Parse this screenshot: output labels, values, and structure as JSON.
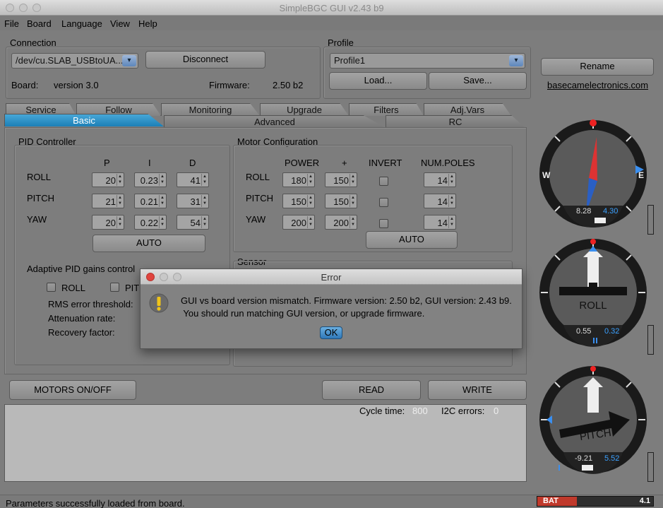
{
  "window": {
    "title": "SimpleBGC GUI v2.43 b9"
  },
  "menu": [
    "File",
    "Board",
    "Language",
    "View",
    "Help"
  ],
  "connection": {
    "title": "Connection",
    "port": "/dev/cu.SLAB_USBtoUA...",
    "disconnect": "Disconnect",
    "board_label": "Board:",
    "board_value": "version 3.0",
    "firmware_label": "Firmware:",
    "firmware_value": "2.50 b2"
  },
  "profile": {
    "title": "Profile",
    "selected": "Profile1",
    "load": "Load...",
    "save": "Save...",
    "rename": "Rename",
    "link": "basecamelectronics.com"
  },
  "tabs_back": [
    "Service",
    "Follow",
    "Monitoring",
    "Upgrade",
    "Filters",
    "Adj.Vars"
  ],
  "tabs_front": [
    "Basic",
    "Advanced",
    "RC"
  ],
  "pid": {
    "title": "PID Controller",
    "cols": [
      "P",
      "I",
      "D"
    ],
    "rows": [
      {
        "name": "ROLL",
        "p": "20",
        "i": "0.23",
        "d": "41"
      },
      {
        "name": "PITCH",
        "p": "21",
        "i": "0.21",
        "d": "31"
      },
      {
        "name": "YAW",
        "p": "20",
        "i": "0.22",
        "d": "54"
      }
    ],
    "auto": "AUTO"
  },
  "motor": {
    "title": "Motor Configuration",
    "cols": [
      "POWER",
      "+",
      "INVERT",
      "NUM.POLES"
    ],
    "rows": [
      {
        "name": "ROLL",
        "power": "180",
        "plus": "150",
        "poles": "14"
      },
      {
        "name": "PITCH",
        "power": "150",
        "plus": "150",
        "poles": "14"
      },
      {
        "name": "YAW",
        "power": "200",
        "plus": "200",
        "poles": "14"
      }
    ],
    "auto": "AUTO"
  },
  "sensor": {
    "title": "Sensor"
  },
  "adaptive": {
    "title": "Adaptive PID gains control",
    "roll": "ROLL",
    "pitch": "PITC",
    "rms": "RMS error threshold:",
    "attenuation": "Attenuation rate:",
    "recovery": "Recovery factor:"
  },
  "actions": {
    "motors": "MOTORS ON/OFF",
    "read": "READ",
    "write": "WRITE"
  },
  "log": {
    "cycle_label": "Cycle time:",
    "cycle_value": "800",
    "i2c_label": "I2C errors:",
    "i2c_value": "0"
  },
  "dialog": {
    "title": "Error",
    "line1": "GUI vs board version mismatch. Firmware version: 2.50 b2, GUI version: 2.43 b9.",
    "line2": " You should run matching GUI version, or upgrade firmware.",
    "ok": "OK"
  },
  "gauges": {
    "yaw": {
      "w": "W",
      "e": "E",
      "left": "8.28",
      "right": "4.30"
    },
    "roll": {
      "label": "ROLL",
      "left": "0.55",
      "right": "0.32"
    },
    "pitch": {
      "label": "PITCH",
      "left": "-9.21",
      "right": "5.52"
    }
  },
  "status": {
    "message": "Parameters successfully loaded from board.",
    "bat_label": "BAT",
    "bat_value": "4.1"
  },
  "colors": {
    "accent": "#1d82c0",
    "value_blue": "#3aa0ff",
    "bat_red": "#c0392b"
  }
}
